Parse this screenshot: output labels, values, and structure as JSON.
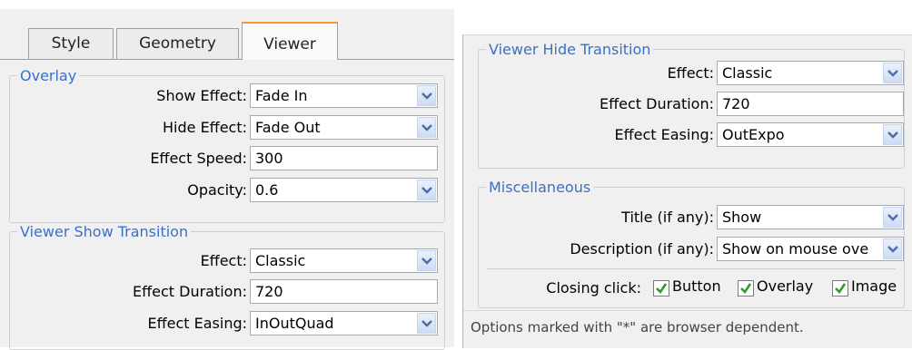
{
  "tabs": [
    "Style",
    "Geometry",
    "Viewer"
  ],
  "overlay": {
    "legend": "Overlay",
    "show_effect": {
      "label": "Show Effect:",
      "value": "Fade In"
    },
    "hide_effect": {
      "label": "Hide Effect:",
      "value": "Fade Out"
    },
    "effect_speed": {
      "label": "Effect Speed:",
      "value": "300"
    },
    "opacity": {
      "label": "Opacity:",
      "value": "0.6"
    }
  },
  "show_transition": {
    "legend": "Viewer Show Transition",
    "effect": {
      "label": "Effect:",
      "value": "Classic"
    },
    "duration": {
      "label": "Effect Duration:",
      "value": "720"
    },
    "easing": {
      "label": "Effect Easing:",
      "value": "InOutQuad"
    }
  },
  "hide_transition": {
    "legend": "Viewer Hide Transition",
    "effect": {
      "label": "Effect:",
      "value": "Classic"
    },
    "duration": {
      "label": "Effect Duration:",
      "value": "720"
    },
    "easing": {
      "label": "Effect Easing:",
      "value": "OutExpo"
    }
  },
  "misc": {
    "legend": "Miscellaneous",
    "title": {
      "label": "Title (if any):",
      "value": "Show"
    },
    "description": {
      "label": "Description (if any):",
      "value": "Show on mouse ove"
    },
    "closing_label": "Closing click:",
    "checks": [
      {
        "label": "Button",
        "checked": true
      },
      {
        "label": "Overlay",
        "checked": true
      },
      {
        "label": "Image",
        "checked": true
      }
    ]
  },
  "footer_note": "Options marked with \"*\" are browser dependent.",
  "colors": {
    "accent_tab": "#f39a2e",
    "legend_text": "#3c6fc6",
    "check_mark": "#2f9a2f"
  }
}
